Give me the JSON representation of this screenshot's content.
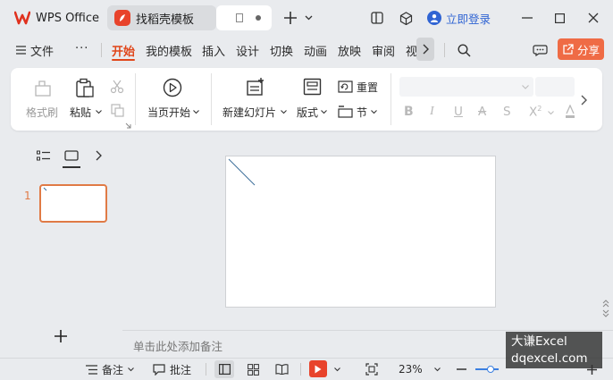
{
  "title_tabs": [
    {
      "label": "WPS Office"
    },
    {
      "label": "找稻壳模板"
    }
  ],
  "title_bar": {
    "login_label": "立即登录"
  },
  "menu": {
    "items": [
      "文件",
      "开始",
      "我的模板",
      "插入",
      "设计",
      "切换",
      "动画",
      "放映",
      "审阅",
      "视"
    ],
    "active": "开始",
    "share_label": "分享"
  },
  "ribbon": {
    "format_painter": "格式刷",
    "paste": "粘贴",
    "start_from_current": "当页开始",
    "new_slide": "新建幻灯片",
    "layout": "版式",
    "reset": "重置",
    "section": "节"
  },
  "slides": {
    "thumbnail_number": "1"
  },
  "notes": {
    "placeholder": "单击此处添加备注"
  },
  "status": {
    "notes_label": "备注",
    "comments_label": "批注",
    "zoom": "23%"
  },
  "watermark": {
    "line1": "大谦Excel",
    "line2": "dqexcel.com"
  },
  "colors": {
    "accent": "#e0461a",
    "share_bg": "#ef6b45",
    "play_red": "#e8432b",
    "login_blue": "#3064d3"
  }
}
